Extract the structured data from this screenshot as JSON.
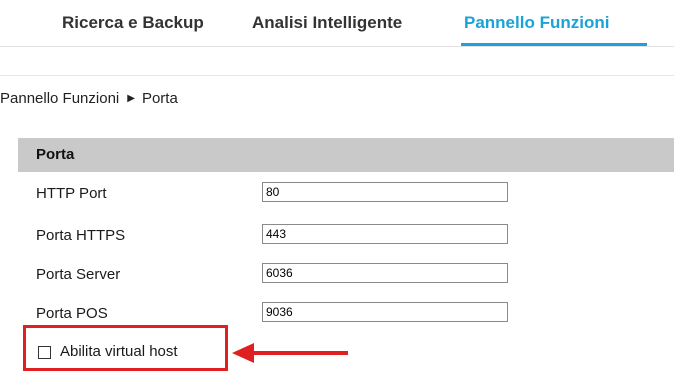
{
  "nav": {
    "tabs": [
      {
        "label": "Ricerca e Backup",
        "active": false
      },
      {
        "label": "Analisi Intelligente",
        "active": false
      },
      {
        "label": "Pannello Funzioni",
        "active": true
      }
    ]
  },
  "breadcrumb": {
    "parent": "Pannello Funzioni",
    "separator": "▶",
    "current": "Porta"
  },
  "section": {
    "title": "Porta"
  },
  "fields": [
    {
      "label": "HTTP Port",
      "value": "80"
    },
    {
      "label": "Porta HTTPS",
      "value": "443"
    },
    {
      "label": "Porta Server",
      "value": "6036"
    },
    {
      "label": "Porta POS",
      "value": "9036"
    }
  ],
  "virtual_host": {
    "label": "Abilita virtual host",
    "checked": false
  },
  "colors": {
    "accent": "#1ba3d8",
    "highlight": "#e02020",
    "section_header_bg": "#c9c9c9"
  }
}
